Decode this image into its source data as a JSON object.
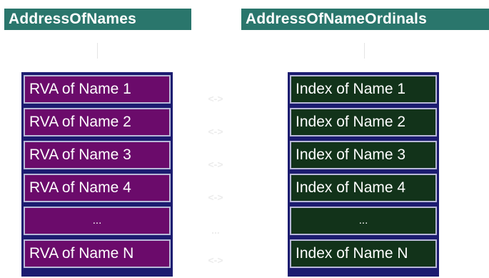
{
  "headers": {
    "left": "AddressOfNames",
    "right": "AddressOfNameOrdinals"
  },
  "left_column": {
    "cells": [
      "RVA of Name 1",
      "RVA of Name 2",
      "RVA of Name 3",
      "RVA of Name 4",
      "...",
      "RVA of Name N"
    ]
  },
  "right_column": {
    "cells": [
      "Index of Name 1",
      "Index of Name 2",
      "Index of Name 3",
      "Index of Name 4",
      "...",
      "Index of Name N"
    ]
  },
  "connectors": [
    "<->",
    "<->",
    "<->",
    "<->",
    "...",
    "<->"
  ],
  "colors": {
    "header_bg": "#2a766c",
    "header_text": "#ffffff",
    "column_border": "#1c1c70",
    "left_cell_bg": "#6b0b6b",
    "right_cell_bg": "#12331a",
    "cell_inner_border": "#b8b8d8",
    "connector_text": "#ececec"
  }
}
